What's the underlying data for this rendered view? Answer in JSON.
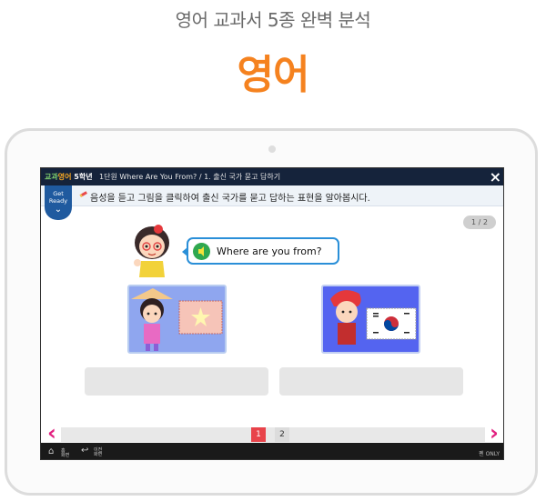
{
  "header": {
    "subtitle": "영어 교과서 5종 완벽 분석",
    "title": "영어"
  },
  "app": {
    "brand_part1": "교과",
    "brand_part2": "영어",
    "brand_part3": "5학년",
    "breadcrumb": "1단원 Where Are You From? / 1. 출신 국가 묻고 답하기",
    "close_icon": "×"
  },
  "getready": {
    "label_line1": "Get",
    "label_line2": "Ready",
    "chevron": "⌄"
  },
  "instruction": "음성을 듣고 그림을 클릭하여 출신 국가를 묻고 답하는 표현을 알아봅시다.",
  "page_indicator": "1 / 2",
  "speech": {
    "text": "Where are you from?",
    "icon": "speaker-icon"
  },
  "pagination": {
    "pages": [
      "1",
      "2"
    ],
    "current": "1",
    "prev": "‹",
    "next": "›"
  },
  "footer": {
    "home_label": "홈\n화면",
    "back_label": "이전\n화면",
    "pen_only": "펜 ONLY"
  },
  "colors": {
    "accent": "#f5821f",
    "topbar": "#15233b",
    "nav_arrow": "#e2207f",
    "current_page": "#e8434a"
  }
}
